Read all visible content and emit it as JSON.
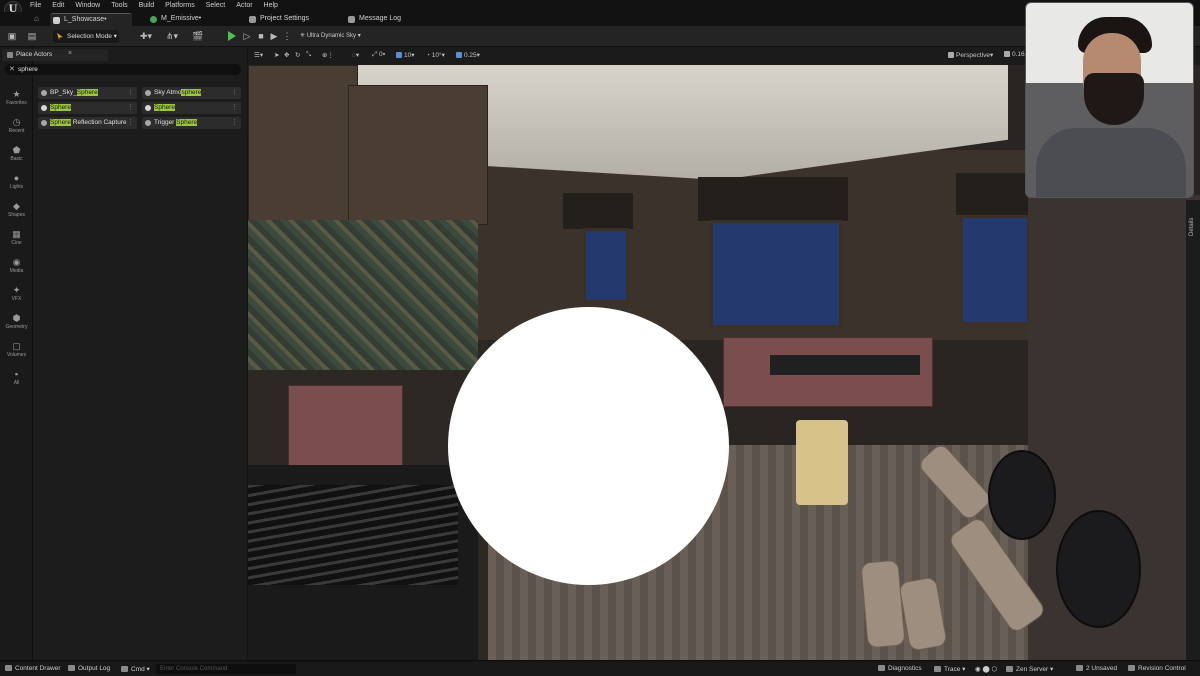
{
  "menu": {
    "items": [
      "File",
      "Edit",
      "Window",
      "Tools",
      "Build",
      "Platforms",
      "Select",
      "Actor",
      "Help"
    ]
  },
  "tabs": [
    {
      "label": "L_Showcase•",
      "active": true,
      "color": "#cfcfcf"
    },
    {
      "label": "M_Emissive•",
      "active": false,
      "color": "#4aa35a"
    },
    {
      "label": "Project Settings",
      "active": false,
      "color": "#9a9a9a"
    },
    {
      "label": "Message Log",
      "active": false,
      "color": "#9a9a9a"
    }
  ],
  "toolbar": {
    "mode_label": "Selection Mode",
    "sky_label": "Ultra Dynamic Sky"
  },
  "categories": [
    {
      "label": "Favorites",
      "icon": "star-icon"
    },
    {
      "label": "Recent",
      "icon": "clock-icon"
    },
    {
      "label": "Basic",
      "icon": "shapes-icon"
    },
    {
      "label": "Lights",
      "icon": "bulb-icon"
    },
    {
      "label": "Shapes",
      "icon": "cube-icon"
    },
    {
      "label": "Cine",
      "icon": "camera-icon"
    },
    {
      "label": "Media",
      "icon": "media-icon"
    },
    {
      "label": "VFX",
      "icon": "sparkle-icon"
    },
    {
      "label": "Geometry",
      "icon": "geometry-icon"
    },
    {
      "label": "Volumes",
      "icon": "volume-icon"
    },
    {
      "label": "All",
      "icon": "all-icon"
    }
  ],
  "place_actors": {
    "title": "Place Actors",
    "search_value": "sphere",
    "results": [
      {
        "pre": "BP_Sky_",
        "match": "Sphere",
        "post": ""
      },
      {
        "pre": "Sky Atmo",
        "match": "sphere",
        "post": ""
      },
      {
        "pre": "",
        "match": "Sphere",
        "post": ""
      },
      {
        "pre": "",
        "match": "Sphere",
        "post": ""
      },
      {
        "pre": "",
        "match": "Sphere",
        "post": " Reflection Capture"
      },
      {
        "pre": "Trigger ",
        "match": "Sphere",
        "post": ""
      }
    ]
  },
  "viewport": {
    "snap_translate": "10",
    "snap_rotate": "10°",
    "snap_scale": "0.25",
    "perspective_label": "Perspective",
    "fov_readout": "0.162",
    "angle_value": "0"
  },
  "details_tab": "Details",
  "statusbar": {
    "content_drawer": "Content Drawer",
    "output_log": "Output Log",
    "cmd": "Cmd",
    "console_placeholder": "Enter Console Command",
    "diagnostics": "Diagnostics",
    "trace": "Trace",
    "zen_server": "Zen Server",
    "unsaved": "2 Unsaved",
    "revision_control": "Revision Control"
  },
  "colors": {
    "highlight": "#9bc640",
    "play": "#4fbf4f",
    "viewport_accent": "#5a8fd6"
  }
}
